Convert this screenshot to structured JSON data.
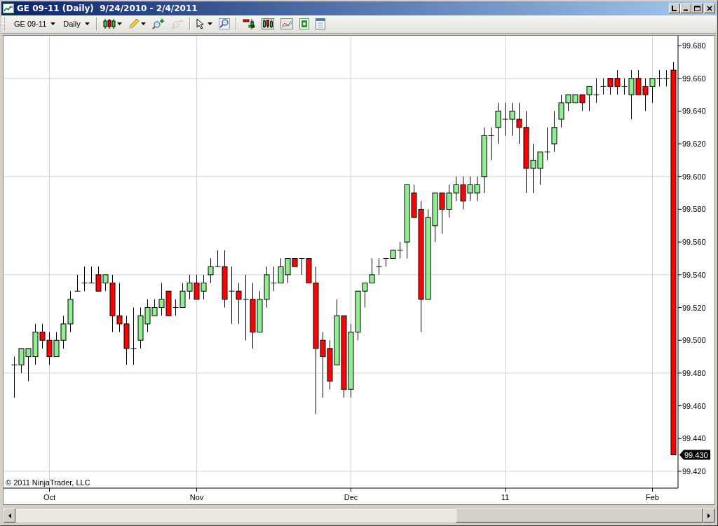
{
  "window": {
    "title": "GE 09-11 (Daily)  9/24/2010 - 2/4/2011"
  },
  "toolbar": {
    "instrument": "GE 09-11",
    "interval": "Daily",
    "tools": [
      {
        "kind": "separator"
      },
      {
        "kind": "chart-style",
        "dropdown": true,
        "disabled": false
      },
      {
        "kind": "drawing",
        "dropdown": true,
        "disabled": false
      },
      {
        "kind": "zoom-in",
        "dropdown": false,
        "disabled": false
      },
      {
        "kind": "zoom-out",
        "dropdown": false,
        "disabled": true
      },
      {
        "kind": "separator"
      },
      {
        "kind": "cursor",
        "dropdown": true,
        "disabled": false
      },
      {
        "kind": "search",
        "dropdown": false,
        "disabled": false
      },
      {
        "kind": "separator"
      },
      {
        "kind": "indicators",
        "dropdown": false,
        "disabled": false
      },
      {
        "kind": "strategies",
        "dropdown": false,
        "disabled": false
      },
      {
        "kind": "overlay",
        "dropdown": false,
        "disabled": false
      },
      {
        "kind": "banknote",
        "dropdown": false,
        "disabled": false
      },
      {
        "kind": "properties",
        "dropdown": false,
        "disabled": false
      }
    ]
  },
  "chart": {
    "copyright": "© 2011 NinjaTrader, LLC",
    "chart_data": {
      "type": "candlestick",
      "categories": [
        null,
        null,
        null,
        null,
        null,
        "Oct",
        null,
        null,
        null,
        null,
        null,
        null,
        null,
        null,
        null,
        null,
        null,
        null,
        null,
        null,
        null,
        null,
        null,
        null,
        null,
        null,
        "Nov",
        null,
        null,
        null,
        null,
        null,
        null,
        null,
        null,
        null,
        null,
        null,
        null,
        null,
        null,
        null,
        null,
        null,
        null,
        null,
        null,
        null,
        "Dec",
        null,
        null,
        null,
        null,
        null,
        null,
        null,
        null,
        null,
        null,
        null,
        null,
        null,
        null,
        null,
        null,
        null,
        null,
        null,
        null,
        null,
        "11",
        null,
        null,
        null,
        null,
        null,
        null,
        null,
        null,
        null,
        null,
        null,
        null,
        null,
        null,
        null,
        null,
        null,
        null,
        null,
        null,
        "Feb",
        null,
        null,
        null
      ],
      "grid": true,
      "ylim": [
        99.4097,
        99.686
      ],
      "yticks": [
        {
          "value": 99.42,
          "label": "99.420"
        },
        {
          "value": 99.44,
          "label": "99.440"
        },
        {
          "value": 99.46,
          "label": "99.460"
        },
        {
          "value": 99.48,
          "label": "99.480"
        },
        {
          "value": 99.5,
          "label": "99.500"
        },
        {
          "value": 99.52,
          "label": "99.520"
        },
        {
          "value": 99.54,
          "label": "99.540"
        },
        {
          "value": 99.56,
          "label": "99.560"
        },
        {
          "value": 99.58,
          "label": "99.580"
        },
        {
          "value": 99.6,
          "label": "99.600"
        },
        {
          "value": 99.62,
          "label": "99.620"
        },
        {
          "value": 99.64,
          "label": "99.640"
        },
        {
          "value": 99.66,
          "label": "99.660"
        },
        {
          "value": 99.68,
          "label": "99.680"
        }
      ],
      "annotations": [
        {
          "y": 99.43,
          "text": "99.430"
        }
      ],
      "ohlc": [
        [
          99.485,
          99.49,
          99.465,
          99.485
        ],
        [
          99.485,
          99.495,
          99.48,
          99.495
        ],
        [
          99.49,
          99.495,
          99.475,
          99.495
        ],
        [
          99.49,
          99.51,
          99.485,
          99.505
        ],
        [
          99.505,
          99.51,
          99.495,
          99.5
        ],
        [
          99.5,
          99.505,
          99.485,
          99.49
        ],
        [
          99.49,
          99.505,
          99.49,
          99.5
        ],
        [
          99.5,
          99.515,
          99.495,
          99.51
        ],
        [
          99.51,
          99.53,
          99.505,
          99.525
        ],
        [
          99.53,
          99.54,
          99.53,
          99.53
        ],
        [
          99.535,
          99.545,
          99.53,
          99.535
        ],
        [
          99.535,
          99.545,
          99.535,
          99.535
        ],
        [
          99.54,
          99.545,
          99.53,
          99.53
        ],
        [
          99.535,
          99.54,
          99.53,
          99.54
        ],
        [
          99.535,
          99.54,
          99.505,
          99.515
        ],
        [
          99.515,
          99.535,
          99.505,
          99.51
        ],
        [
          99.51,
          99.515,
          99.485,
          99.495
        ],
        [
          99.495,
          99.52,
          99.485,
          99.495
        ],
        [
          99.5,
          99.52,
          99.495,
          99.515
        ],
        [
          99.51,
          99.525,
          99.505,
          99.52
        ],
        [
          99.515,
          99.525,
          99.515,
          99.52
        ],
        [
          99.52,
          99.535,
          99.515,
          99.525
        ],
        [
          99.53,
          99.53,
          99.515,
          99.515
        ],
        [
          99.52,
          99.525,
          99.515,
          99.52
        ],
        [
          99.52,
          99.535,
          99.52,
          99.53
        ],
        [
          99.53,
          99.54,
          99.525,
          99.535
        ],
        [
          99.535,
          99.54,
          99.525,
          99.525
        ],
        [
          99.53,
          99.54,
          99.525,
          99.535
        ],
        [
          99.54,
          99.55,
          99.535,
          99.545
        ],
        [
          99.545,
          99.555,
          99.545,
          99.545
        ],
        [
          99.545,
          99.555,
          99.52,
          99.525
        ],
        [
          99.53,
          99.545,
          99.51,
          99.53
        ],
        [
          99.53,
          99.535,
          99.51,
          99.525
        ],
        [
          99.525,
          99.54,
          99.5,
          99.525
        ],
        [
          99.525,
          99.535,
          99.495,
          99.505
        ],
        [
          99.505,
          99.53,
          99.505,
          99.525
        ],
        [
          99.525,
          99.545,
          99.52,
          99.54
        ],
        [
          99.535,
          99.545,
          99.53,
          99.535
        ],
        [
          99.535,
          99.55,
          99.535,
          99.545
        ],
        [
          99.54,
          99.55,
          99.535,
          99.55
        ],
        [
          99.55,
          99.55,
          99.545,
          99.545
        ],
        [
          99.55,
          99.55,
          99.54,
          99.55
        ],
        [
          99.55,
          99.55,
          99.535,
          99.535
        ],
        [
          99.535,
          99.545,
          99.455,
          99.495
        ],
        [
          99.5,
          99.505,
          99.465,
          99.49
        ],
        [
          99.495,
          99.5,
          99.47,
          99.475
        ],
        [
          99.485,
          99.525,
          99.485,
          99.515
        ],
        [
          99.515,
          99.515,
          99.465,
          99.47
        ],
        [
          99.47,
          99.51,
          99.465,
          99.505
        ],
        [
          99.505,
          99.53,
          99.5,
          99.53
        ],
        [
          99.53,
          99.535,
          99.52,
          99.535
        ],
        [
          99.535,
          99.55,
          99.535,
          99.54
        ],
        [
          99.545,
          99.55,
          99.54,
          99.545
        ],
        [
          99.55,
          99.55,
          99.545,
          99.55
        ],
        [
          99.55,
          99.555,
          99.55,
          99.555
        ],
        [
          99.555,
          99.56,
          99.55,
          99.555
        ],
        [
          99.56,
          99.595,
          99.55,
          99.595
        ],
        [
          99.59,
          99.595,
          99.575,
          99.575
        ],
        [
          99.58,
          99.585,
          99.505,
          99.525
        ],
        [
          99.525,
          99.58,
          99.525,
          99.575
        ],
        [
          99.57,
          99.59,
          99.56,
          99.59
        ],
        [
          99.59,
          99.59,
          99.565,
          99.58
        ],
        [
          99.58,
          99.595,
          99.575,
          99.59
        ],
        [
          99.59,
          99.6,
          99.585,
          99.595
        ],
        [
          99.595,
          99.6,
          99.58,
          99.585
        ],
        [
          99.59,
          99.6,
          99.585,
          99.595
        ],
        [
          99.59,
          99.6,
          99.585,
          99.595
        ],
        [
          99.6,
          99.63,
          99.59,
          99.625
        ],
        [
          99.625,
          99.63,
          99.61,
          99.625
        ],
        [
          99.63,
          99.645,
          99.62,
          99.64
        ],
        [
          99.635,
          99.645,
          99.625,
          99.635
        ],
        [
          99.635,
          99.645,
          99.625,
          99.64
        ],
        [
          99.635,
          99.645,
          99.62,
          99.63
        ],
        [
          99.63,
          99.64,
          99.59,
          99.605
        ],
        [
          99.605,
          99.62,
          99.59,
          99.61
        ],
        [
          99.605,
          99.615,
          99.595,
          99.615
        ],
        [
          99.615,
          99.63,
          99.61,
          99.615
        ],
        [
          99.62,
          99.64,
          99.615,
          99.63
        ],
        [
          99.635,
          99.65,
          99.63,
          99.645
        ],
        [
          99.645,
          99.65,
          99.64,
          99.65
        ],
        [
          99.645,
          99.65,
          99.645,
          99.65
        ],
        [
          99.65,
          99.65,
          99.64,
          99.645
        ],
        [
          99.65,
          99.655,
          99.64,
          99.655
        ],
        [
          99.65,
          99.66,
          99.645,
          99.65
        ],
        [
          99.655,
          99.66,
          99.65,
          99.655
        ],
        [
          99.66,
          99.66,
          99.65,
          99.655
        ],
        [
          99.66,
          99.665,
          99.65,
          99.655
        ],
        [
          99.655,
          99.66,
          99.65,
          99.655
        ],
        [
          99.65,
          99.665,
          99.635,
          99.66
        ],
        [
          99.66,
          99.665,
          99.65,
          99.65
        ],
        [
          99.655,
          99.66,
          99.64,
          99.65
        ],
        [
          99.655,
          99.66,
          99.645,
          99.66
        ],
        [
          99.66,
          99.665,
          99.655,
          99.66
        ],
        [
          99.66,
          99.665,
          99.655,
          99.66
        ],
        [
          99.665,
          99.67,
          99.43,
          99.43
        ]
      ]
    }
  }
}
